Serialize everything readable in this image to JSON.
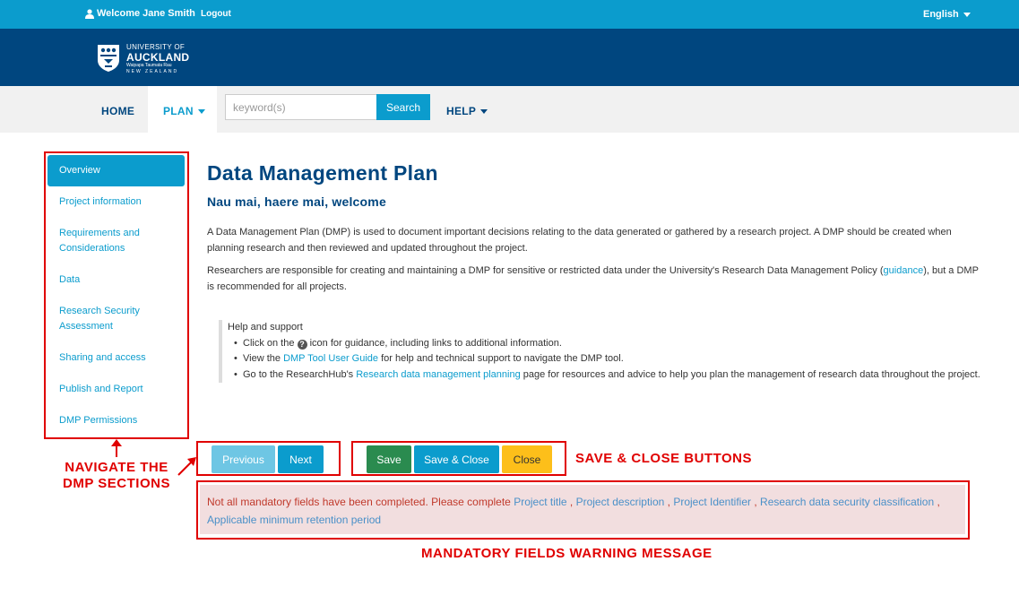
{
  "topbar": {
    "welcome": "Welcome Jane Smith",
    "logout": "Logout",
    "language": "English"
  },
  "brand": {
    "line1": "UNIVERSITY OF",
    "line2": "AUCKLAND",
    "line3": "Waipapa Taumata Rau",
    "line4": "NEW ZEALAND"
  },
  "nav": {
    "home": "HOME",
    "plan": "PLAN",
    "search_placeholder": "keyword(s)",
    "search_button": "Search",
    "help": "HELP"
  },
  "sidebar": {
    "items": [
      {
        "label": "Overview",
        "active": true
      },
      {
        "label": "Project information"
      },
      {
        "label": "Requirements and Considerations"
      },
      {
        "label": "Data"
      },
      {
        "label": "Research Security Assessment"
      },
      {
        "label": "Sharing and access"
      },
      {
        "label": "Publish and Report"
      },
      {
        "label": "DMP Permissions"
      }
    ]
  },
  "main": {
    "title": "Data Management Plan",
    "subtitle": "Nau mai, haere mai, welcome",
    "para1": "A Data Management Plan (DMP) is used to document important decisions relating to the data generated or gathered by a research project. A DMP should be created when planning research and then reviewed and updated throughout the project.",
    "para2_pre": "Researchers are responsible for creating and maintaining a DMP for sensitive or restricted data under the University's Research Data Management Policy (",
    "para2_link": "guidance",
    "para2_post": "), but a DMP is recommended for all projects."
  },
  "help": {
    "title": "Help and support",
    "b1_pre": "Click on the",
    "b1_post": "icon for guidance, including links to additional information.",
    "b2_pre": "View the",
    "b2_link": "DMP Tool User Guide",
    "b2_post": "for help and technical support to navigate the DMP tool.",
    "b3_pre": "Go to the ResearchHub's",
    "b3_link": "Research data management planning",
    "b3_post": "page for resources and advice to help you plan the management of research data throughout the project."
  },
  "buttons": {
    "previous": "Previous",
    "next": "Next",
    "save": "Save",
    "save_close": "Save & Close",
    "close": "Close"
  },
  "warning": {
    "text": "Not all mandatory fields have been completed. Please complete",
    "fields": [
      "Project title",
      "Project description",
      "Project Identifier",
      "Research data security classification",
      "Applicable minimum retention period"
    ]
  },
  "annotations": {
    "navigate_line1": "NAVIGATE THE",
    "navigate_line2": "DMP SECTIONS",
    "save_close": "SAVE & CLOSE BUTTONS",
    "mandatory": "MANDATORY FIELDS WARNING MESSAGE"
  },
  "colors": {
    "accent": "#0b9ccd",
    "brand": "#00467f",
    "annotation": "#e00000",
    "save": "#2a8b4f",
    "close": "#fdbf1a",
    "warning_bg": "#f2dedf"
  }
}
